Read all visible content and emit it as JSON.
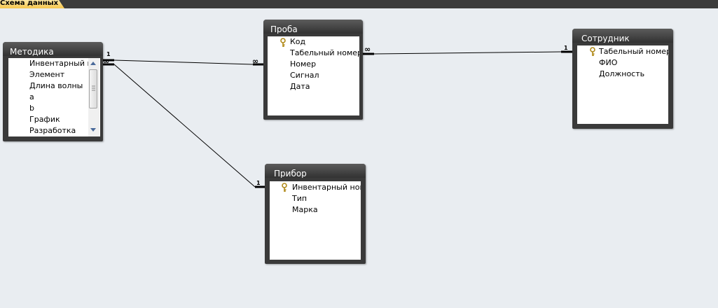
{
  "document_tab": {
    "label": "Схема данных"
  },
  "tables": {
    "metodika": {
      "title": "Методика",
      "fields": [
        "Инвентарный н",
        "Элемент",
        "Длина волны",
        "a",
        "b",
        "График",
        "Разработка"
      ]
    },
    "proba": {
      "title": "Проба",
      "fields": [
        "Код",
        "Табельный номер",
        "Номер",
        "Сигнал",
        "Дата"
      ],
      "key_field": "Код"
    },
    "sotrudnik": {
      "title": "Сотрудник",
      "fields": [
        "Табельный номер",
        "ФИО",
        "Должность"
      ],
      "key_field": "Табельный номер"
    },
    "pribor": {
      "title": "Прибор",
      "fields": [
        "Инвентарный ном",
        "Тип",
        "Марка"
      ],
      "key_field": "Инвентарный ном"
    }
  },
  "relationships": [
    {
      "from": "Методика",
      "to": "Проба",
      "from_cardinality": "1",
      "to_cardinality": "∞"
    },
    {
      "from": "Методика",
      "to": "Прибор",
      "from_cardinality": "∞",
      "to_cardinality": "1"
    },
    {
      "from": "Проба",
      "to": "Сотрудник",
      "from_cardinality": "∞",
      "to_cardinality": "1"
    }
  ],
  "icons": {
    "key": "key-icon",
    "scroll_up": "scroll-up-arrow-icon",
    "scroll_down": "scroll-down-arrow-icon"
  },
  "colors": {
    "canvas": "#e9edf1",
    "title_bar": "#3a3a3a",
    "tab": "#f6c64e"
  }
}
